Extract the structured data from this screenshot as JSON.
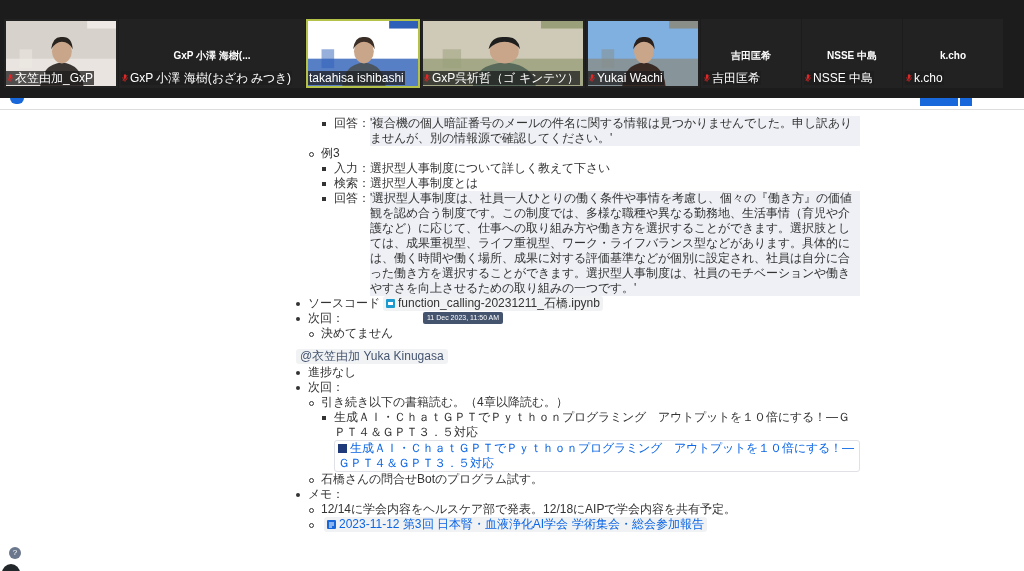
{
  "call_strip": {
    "participants": [
      {
        "kind": "video",
        "label": "衣笠由加_GxP",
        "muted": true,
        "selected": false
      },
      {
        "kind": "name",
        "display_name": "GxP 小澤 海樹(...",
        "label": "GxP 小澤 海樹(おざわ みつき)",
        "muted": true,
        "selected": false
      },
      {
        "kind": "video",
        "label": "takahisa ishibashi",
        "muted": false,
        "selected": true
      },
      {
        "kind": "video",
        "label": "GxP呉祈哲（ゴ キンテツ）",
        "muted": true,
        "selected": false
      },
      {
        "kind": "video",
        "label": "Yukai Wachi",
        "muted": true,
        "selected": false
      },
      {
        "kind": "name",
        "display_name": "吉田匡希",
        "label": "吉田匡希",
        "muted": true,
        "selected": false
      },
      {
        "kind": "name",
        "display_name": "NSSE 中島",
        "label": "NSSE 中島",
        "muted": true,
        "selected": false
      },
      {
        "kind": "name",
        "display_name": "k.cho",
        "label": "k.cho",
        "muted": true,
        "selected": false
      }
    ]
  },
  "page": {
    "outline": [
      {
        "children": [
          {
            "children": [
              {
                "text": "回答：",
                "quote": "'複合機の個人暗証番号のメールの件名に関する情報は見つかりませんでした。申し訳ありませんが、別の情報源で確認してください。'"
              }
            ]
          },
          {
            "text": "例3",
            "children": [
              {
                "text": "入力：選択型人事制度について詳しく教えて下さい"
              },
              {
                "text": "検索：選択型人事制度とは"
              },
              {
                "text": "回答：",
                "quote": "'選択型人事制度は、社員一人ひとりの働く条件や事情を考慮し、個々の『働き方』の価値観を認め合う制度です。この制度では、多様な職種や異なる勤務地、生活事情（育児や介護など）に応じて、仕事への取り組み方や働き方を選択することができます。選択肢としては、成果重視型、ライフ重視型、ワーク・ライフバランス型などがあります。具体的には、働く時間や働く場所、成果に対する評価基準などが個別に設定され、社員は自分に合った働き方を選択することができます。選択型人事制度は、社員のモチベーションや働きやすさを向上させるための取り組みの一つです。'"
              }
            ]
          }
        ]
      },
      {
        "text": "ソースコード",
        "attachment": {
          "kind": "file",
          "label": "function_calling-20231211_石橋.ipynb",
          "tooltip": "11 Dec 2023, 11:50 AM"
        }
      },
      {
        "text": "次回：",
        "children": [
          {
            "text": "決めてません"
          }
        ]
      }
    ],
    "mention": "@衣笠由加 Yuka Kinugasa",
    "outline_2": [
      {
        "text": "進捗なし"
      },
      {
        "text": "次回：",
        "children": [
          {
            "text": "引き続き以下の書籍読む。（4章以降読む。）",
            "children": [
              {
                "text": "生成ＡＩ・ＣｈａｔＧＰＴでＰｙｔｈｏｎプログラミング　アウトプットを１０倍にする！―ＧＰＴ４＆ＧＰＴ３．５対応",
                "attachment": {
                  "kind": "book",
                  "label": "生成ＡＩ・ＣｈａｔＧＰＴでＰｙｔｈｏｎプログラミング　アウトプットを１０倍にする！―ＧＰＴ４＆ＧＰＴ３．５対応"
                }
              }
            ]
          },
          {
            "text": "石橋さんの問合せBotのプログラム試す。"
          }
        ]
      },
      {
        "text": "メモ：",
        "children": [
          {
            "text": "12/14に学会内容をヘルスケア部で発表。12/18にAIPで学会内容を共有予定。"
          },
          {
            "attachment": {
              "kind": "page",
              "label": "2023-11-12 第3回 日本腎・血液浄化AI学会 学術集会・総会参加報告"
            }
          }
        ]
      }
    ]
  },
  "help_button": "?"
}
